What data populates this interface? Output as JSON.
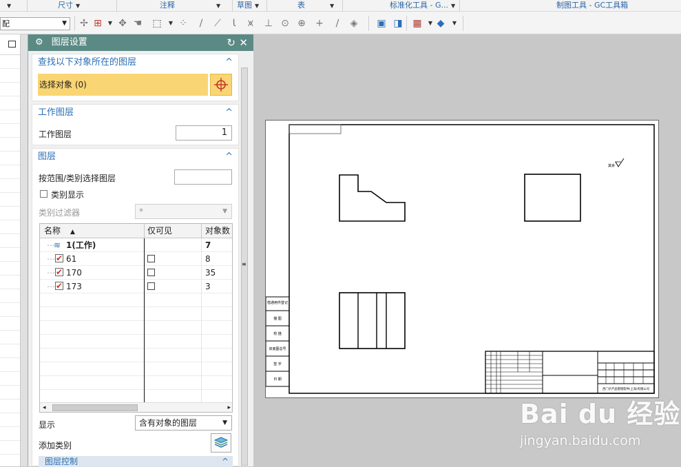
{
  "ribbon": {
    "groups": [
      {
        "label": "尺寸"
      },
      {
        "label": "注释"
      },
      {
        "label": "草图"
      },
      {
        "label": "表"
      },
      {
        "label": "标准化工具 - G..."
      },
      {
        "label": "制图工具 - GC工具箱"
      }
    ]
  },
  "toolbar": {
    "filter_value": "配"
  },
  "dialog": {
    "title": "图层设置",
    "find_section": {
      "title": "查找以下对象所在的图层",
      "select_label": "选择对象 (0)"
    },
    "work_layer_section": {
      "title": "工作图层",
      "label": "工作图层",
      "value": "1"
    },
    "layers_section": {
      "title": "图层",
      "range_label": "按范围/类别选择图层",
      "category_display_label": "类别显示",
      "category_filter_label": "类别过滤器",
      "category_filter_value": "*",
      "columns": {
        "name": "名称",
        "visible_only": "仅可见",
        "count": "对象数"
      },
      "rows": [
        {
          "name": "1(工作)",
          "count": "7"
        },
        {
          "name": "61",
          "count": "8"
        },
        {
          "name": "170",
          "count": "35"
        },
        {
          "name": "173",
          "count": "3"
        }
      ],
      "display_label": "显示",
      "display_value": "含有对象的图层",
      "add_category_label": "添加类别"
    },
    "layer_control_section": {
      "title": "图层控制"
    }
  },
  "drawing": {
    "roughness_note": "其余",
    "left_column_labels": [
      "借通用件登记",
      "描 图",
      "校 描",
      "旧底图总号",
      "签 字",
      "日 期"
    ],
    "company_name": "西门子产品管理软件(上海)有限公司"
  },
  "watermark": {
    "logo": "Bai du 经验",
    "url": "jingyan.baidu.com"
  },
  "colors": {
    "dialog_title_bg": "#5b8a85",
    "section_title": "#2b6fb6",
    "selection_highlight": "#fad573"
  }
}
